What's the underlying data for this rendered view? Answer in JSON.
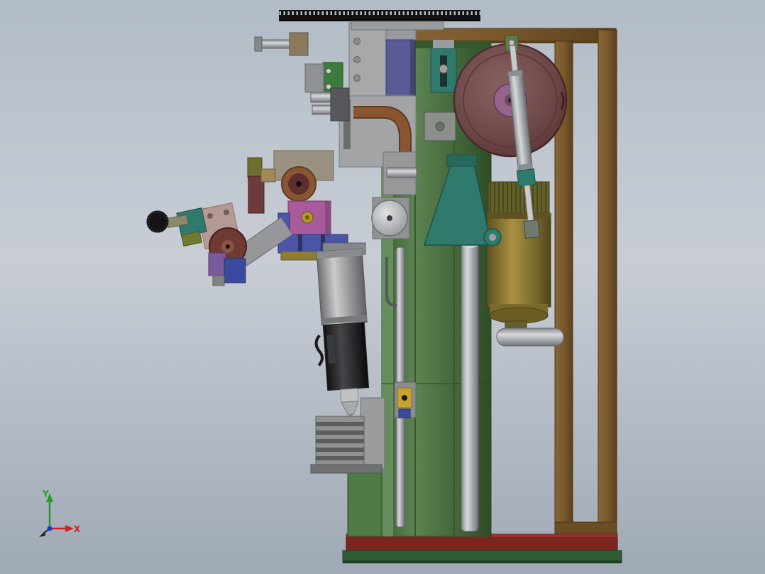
{
  "viewport": {
    "background": {
      "top": "#b2bcc6",
      "middle": "#c8cdd5",
      "bottom": "#9fa9b5"
    }
  },
  "triad": {
    "y_label": "Y",
    "x_label": "X",
    "y_color": "#1fa11f",
    "x_color": "#d42222",
    "z_color": "#1a3acc"
  },
  "machine": {
    "colors": {
      "rack_black": "#121212",
      "frame_brown": "#7a592c",
      "frame_brown_dark": "#5a401d",
      "base_red": "#7c2420",
      "base_green": "#2f5d33",
      "column_green": "#4f7a46",
      "column_green_dark": "#2c4724",
      "column_green_light": "#6d9464",
      "disc_maroon": "#6f4040",
      "disc_rim": "#4a2626",
      "hub_purple": "#96638b",
      "motor_gold": "#8f7c33",
      "motor_fins": "#63602a",
      "bracket_teal": "#2f7a6c",
      "cylinder_silver": "#b9bcc0",
      "head_gray": "#a6a8aa",
      "copper_tube": "#8a5632",
      "block_blue": "#5a5a96",
      "block_green": "#3d7a3d",
      "clamp_blue": "#4a55a8",
      "block_magenta": "#a85a9a",
      "spool_red": "#5f2f2f",
      "actuator_black": "#26262a",
      "knob_black": "#141414",
      "plate_pink": "#b59a94",
      "block_purple": "#7a5a9a",
      "sensor_yellow": "#c8a22e"
    }
  }
}
